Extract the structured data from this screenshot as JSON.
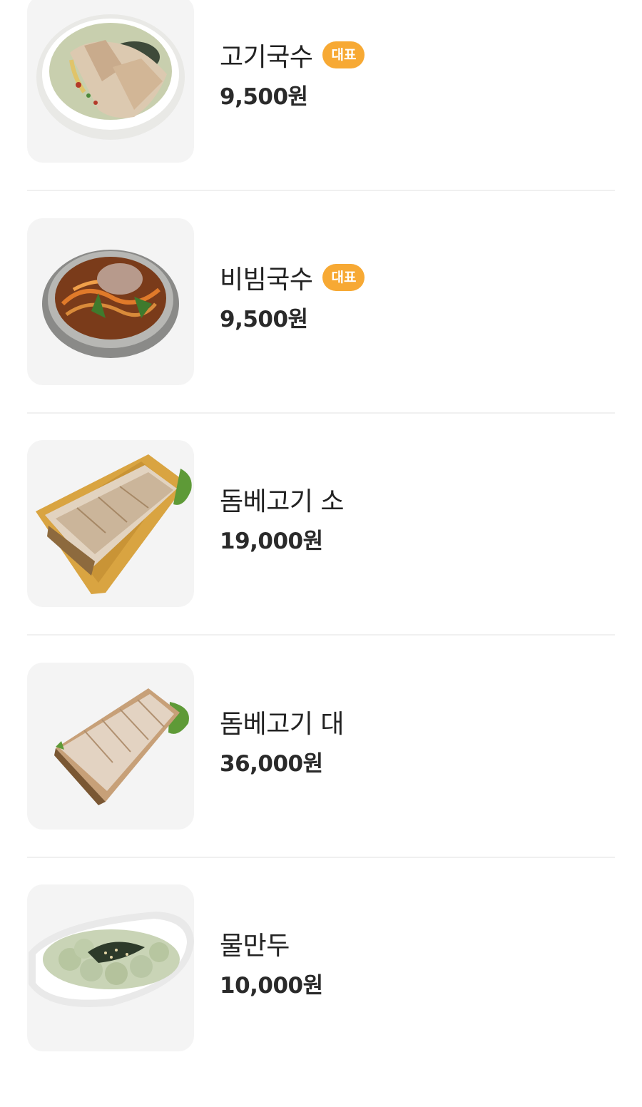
{
  "menu": {
    "badge_label": "대표",
    "currency_suffix": "원",
    "items": [
      {
        "name": "고기국수",
        "price": "9,500원",
        "featured": true,
        "image": "noodle-soup-with-pork-photo"
      },
      {
        "name": "비빔국수",
        "price": "9,500원",
        "featured": true,
        "image": "spicy-mixed-noodles-photo"
      },
      {
        "name": "돔베고기 소",
        "price": "19,000원",
        "featured": false,
        "image": "sliced-pork-board-small-photo"
      },
      {
        "name": "돔베고기 대",
        "price": "36,000원",
        "featured": false,
        "image": "sliced-pork-board-large-photo"
      },
      {
        "name": "물만두",
        "price": "10,000원",
        "featured": false,
        "image": "boiled-dumplings-photo"
      }
    ]
  },
  "colors": {
    "badge_bg": "#f7a934",
    "thumb_bg": "#f4f4f4",
    "divider": "#f0f0f0"
  }
}
